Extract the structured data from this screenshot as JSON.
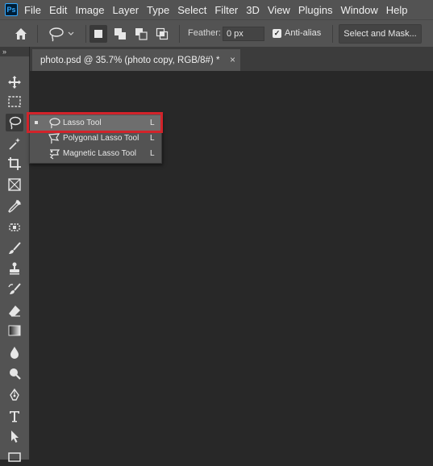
{
  "app": {
    "logo_text": "Ps"
  },
  "menu": [
    "File",
    "Edit",
    "Image",
    "Layer",
    "Type",
    "Select",
    "Filter",
    "3D",
    "View",
    "Plugins",
    "Window",
    "Help"
  ],
  "options_bar": {
    "feather_label": "Feather:",
    "feather_value": "0 px",
    "antialias_label": "Anti-alias",
    "antialias_checked": true,
    "select_mask_label": "Select and Mask..."
  },
  "toolbar": {
    "collapse_glyph": "»"
  },
  "document": {
    "tab_title": "photo.psd @ 35.7% (photo copy, RGB/8#) *",
    "close_glyph": "×"
  },
  "flyout": {
    "items": [
      {
        "label": "Lasso Tool",
        "shortcut": "L",
        "icon": "lasso-icon",
        "selected": true
      },
      {
        "label": "Polygonal Lasso Tool",
        "shortcut": "L",
        "icon": "polygonal-lasso-icon",
        "selected": false
      },
      {
        "label": "Magnetic Lasso Tool",
        "shortcut": "L",
        "icon": "magnetic-lasso-icon",
        "selected": false
      }
    ],
    "highlight_color": "#d2232a"
  }
}
